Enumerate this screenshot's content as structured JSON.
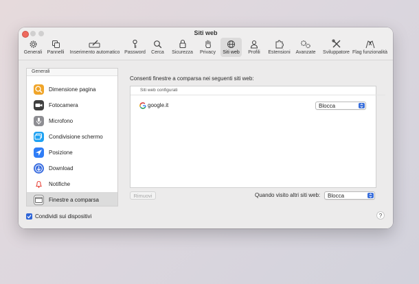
{
  "window": {
    "title": "Siti web"
  },
  "toolbar": {
    "items": [
      {
        "label": "Generali",
        "icon": "gear-icon"
      },
      {
        "label": "Pannelli",
        "icon": "tabs-icon"
      },
      {
        "label": "Inserimento automatico",
        "icon": "pencil-field-icon"
      },
      {
        "label": "Password",
        "icon": "key-icon"
      },
      {
        "label": "Cerca",
        "icon": "magnifier-icon"
      },
      {
        "label": "Sicurezza",
        "icon": "lock-icon"
      },
      {
        "label": "Privacy",
        "icon": "hand-icon"
      },
      {
        "label": "Siti web",
        "icon": "globe-icon"
      },
      {
        "label": "Profili",
        "icon": "person-icon"
      },
      {
        "label": "Estensioni",
        "icon": "puzzle-icon"
      },
      {
        "label": "Avanzate",
        "icon": "gears-icon"
      },
      {
        "label": "Sviluppatore",
        "icon": "tools-icon"
      },
      {
        "label": "Flag funzionalità",
        "icon": "flags-icon"
      }
    ],
    "active": "Siti web"
  },
  "sidebar": {
    "section_title": "Generali",
    "items": [
      {
        "label": "Dimensione pagina",
        "icon": "zoom-icon",
        "color": "#f0a52a"
      },
      {
        "label": "Fotocamera",
        "icon": "camera-icon",
        "color": "#3f3f3f"
      },
      {
        "label": "Microfono",
        "icon": "microphone-icon",
        "color": "#8e8e93"
      },
      {
        "label": "Condivisione schermo",
        "icon": "screen-share-icon",
        "color": "#1ea1f2"
      },
      {
        "label": "Posizione",
        "icon": "location-icon",
        "color": "#2f7df6"
      },
      {
        "label": "Download",
        "icon": "download-icon",
        "color": "#3b6ee0"
      },
      {
        "label": "Notifiche",
        "icon": "bell-icon",
        "color": "#e8463c"
      },
      {
        "label": "Finestre a comparsa",
        "icon": "popup-window-icon",
        "color": "#ffffff"
      }
    ],
    "selected": "Finestre a comparsa"
  },
  "main": {
    "heading": "Consenti finestre a comparsa nei seguenti siti web:",
    "list_header": "Siti web configurati",
    "sites": [
      {
        "name": "google.it",
        "setting": "Blocca"
      }
    ],
    "remove_button": "Rimuovi",
    "other_sites_label": "Quando visito altri siti web:",
    "other_sites_value": "Blocca"
  },
  "footer": {
    "share_label": "Condividi sui dispositivi",
    "share_checked": true,
    "help_label": "?"
  },
  "colors": {
    "accent": "#2f65d6",
    "close": "#ee6a5e"
  }
}
